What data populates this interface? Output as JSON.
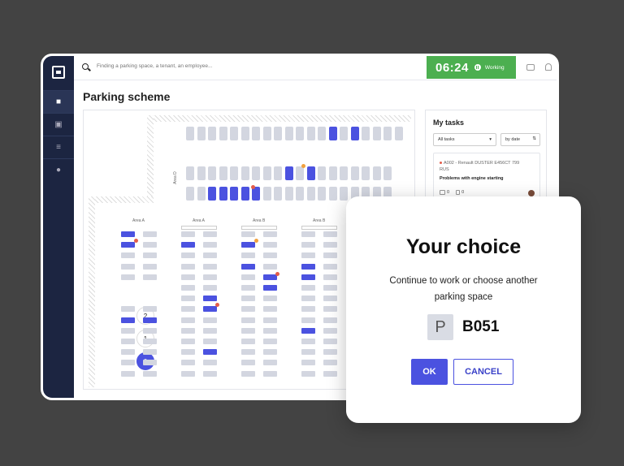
{
  "topbar": {
    "search_placeholder": "Finding a parking space, a tenant, an employee...",
    "timer": "06:24",
    "status": "Working"
  },
  "page": {
    "title": "Parking scheme"
  },
  "map": {
    "area_labels": [
      "Area A",
      "Area A",
      "Area B",
      "Area B"
    ],
    "area_side_label": "Area D",
    "floors": [
      "2",
      "1",
      "0"
    ],
    "active_floor": "0"
  },
  "tasks": {
    "title": "My tasks",
    "filter": "All tasks",
    "sort": "by date",
    "card": {
      "header": "A002 - Renault DUSTER E456CT 799 RUS",
      "subtitle": "Problems with engine starting",
      "comments": "0",
      "files": "0"
    }
  },
  "modal": {
    "title": "Your choice",
    "text": "Continue to work or choose another parking space",
    "badge": "P",
    "spot": "B051",
    "ok_label": "OK",
    "cancel_label": "CANCEL"
  },
  "colors": {
    "accent": "#4b52e0",
    "working": "#4caf50",
    "sidebar": "#1c2541"
  }
}
